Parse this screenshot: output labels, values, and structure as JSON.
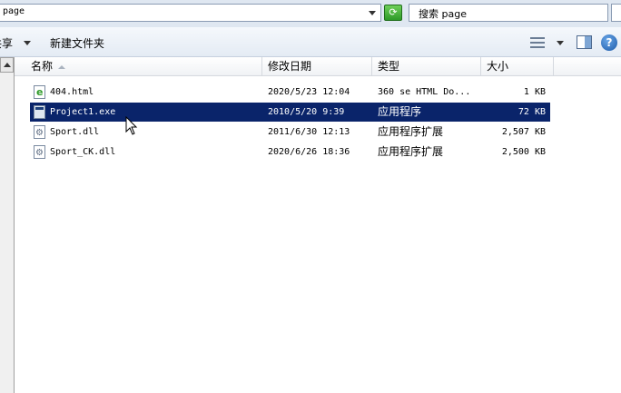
{
  "address_bar": {
    "path": "page"
  },
  "search": {
    "text": "搜索 page"
  },
  "toolbar": {
    "share_label": "共享",
    "new_folder_label": "新建文件夹"
  },
  "columns": {
    "name": "名称",
    "date": "修改日期",
    "type": "类型",
    "size": "大小"
  },
  "files": [
    {
      "name": "404.html",
      "date": "2020/5/23 12:04",
      "type": "360 se HTML Do...",
      "size": "1 KB",
      "icon": "html-file-icon",
      "selected": false
    },
    {
      "name": "Project1.exe",
      "date": "2010/5/20 9:39",
      "type": "应用程序",
      "size": "72 KB",
      "icon": "exe-file-icon",
      "selected": true
    },
    {
      "name": "Sport.dll",
      "date": "2011/6/30 12:13",
      "type": "应用程序扩展",
      "size": "2,507 KB",
      "icon": "dll-file-icon",
      "selected": false
    },
    {
      "name": "Sport_CK.dll",
      "date": "2020/6/26 18:36",
      "type": "应用程序扩展",
      "size": "2,500 KB",
      "icon": "dll-file-icon",
      "selected": false
    }
  ],
  "colors": {
    "selection": "#0a246a",
    "toolbar": "#e4ebf4"
  }
}
